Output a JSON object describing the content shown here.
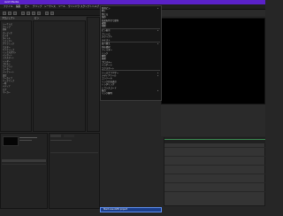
{
  "window": {
    "title": "Avid Media"
  },
  "menubar": {
    "items": [
      "ファイル",
      "編集",
      "ビン",
      "クリップ",
      "シーケンス",
      "ツール",
      "ウインドウ",
      "スクリプト",
      "ヘルプ"
    ]
  },
  "project_panel": {
    "title": "プロジェクト",
    "tab": "ビン",
    "items": [
      "シーケンス",
      "クリップ",
      "素材",
      "オーディオ",
      "ビデオ",
      "タイトル",
      "エフェクト",
      "グラフィック",
      "マスター",
      "サブクリップ",
      "ミックスダウン",
      "インポート",
      "エクスポート",
      "レンダー",
      "プロキシ",
      "ライブラリ",
      "ユーザー",
      "テンプレート",
      "設定",
      "アーカイブ",
      "バックアップ",
      "一時",
      "メディア",
      "ログ",
      "マーカー"
    ]
  },
  "context_menu": {
    "items": [
      {
        "label": "新規ビン",
        "arrow": true
      },
      {
        "label": "開く",
        "arrow": false
      },
      {
        "label": "閉じる",
        "arrow": false
      },
      {
        "label": "保存",
        "arrow": false
      },
      {
        "label": "名前を付けて保存",
        "arrow": false
      },
      {
        "label": "複製",
        "arrow": false
      },
      {
        "label": "削除",
        "arrow": false
      },
      {
        "label": "ビン表示",
        "arrow": true
      },
      {
        "label": "フレーム",
        "arrow": false
      },
      {
        "label": "スクリプト",
        "arrow": false
      },
      {
        "label": "テキスト",
        "arrow": false
      },
      {
        "label": "並べ替え",
        "arrow": true
      },
      {
        "label": "列の選択",
        "arrow": false
      },
      {
        "label": "フィルター",
        "arrow": false
      },
      {
        "label": "リンク",
        "arrow": false
      },
      {
        "label": "解除",
        "arrow": false
      },
      {
        "label": "検索",
        "arrow": false
      },
      {
        "label": "プロパティ",
        "arrow": false
      },
      {
        "label": "インポート",
        "arrow": false
      },
      {
        "label": "エクスポート",
        "arrow": false
      },
      {
        "label": "ソースブラウザー",
        "arrow": true
      },
      {
        "label": "メディアツール",
        "arrow": true
      },
      {
        "label": "コンソール",
        "arrow": false
      },
      {
        "label": "リンク先を表示",
        "arrow": false
      },
      {
        "label": "レンダリング",
        "arrow": false
      },
      {
        "label": "トランスコード",
        "arrow": false
      },
      {
        "label": "統合",
        "arrow": true
      },
      {
        "label": "リンク解除",
        "arrow": false
      }
    ],
    "highlighted": "Start new AVID project"
  },
  "viewer": {
    "label": "レコード"
  },
  "timeline": {
    "label": "タイムライン"
  }
}
